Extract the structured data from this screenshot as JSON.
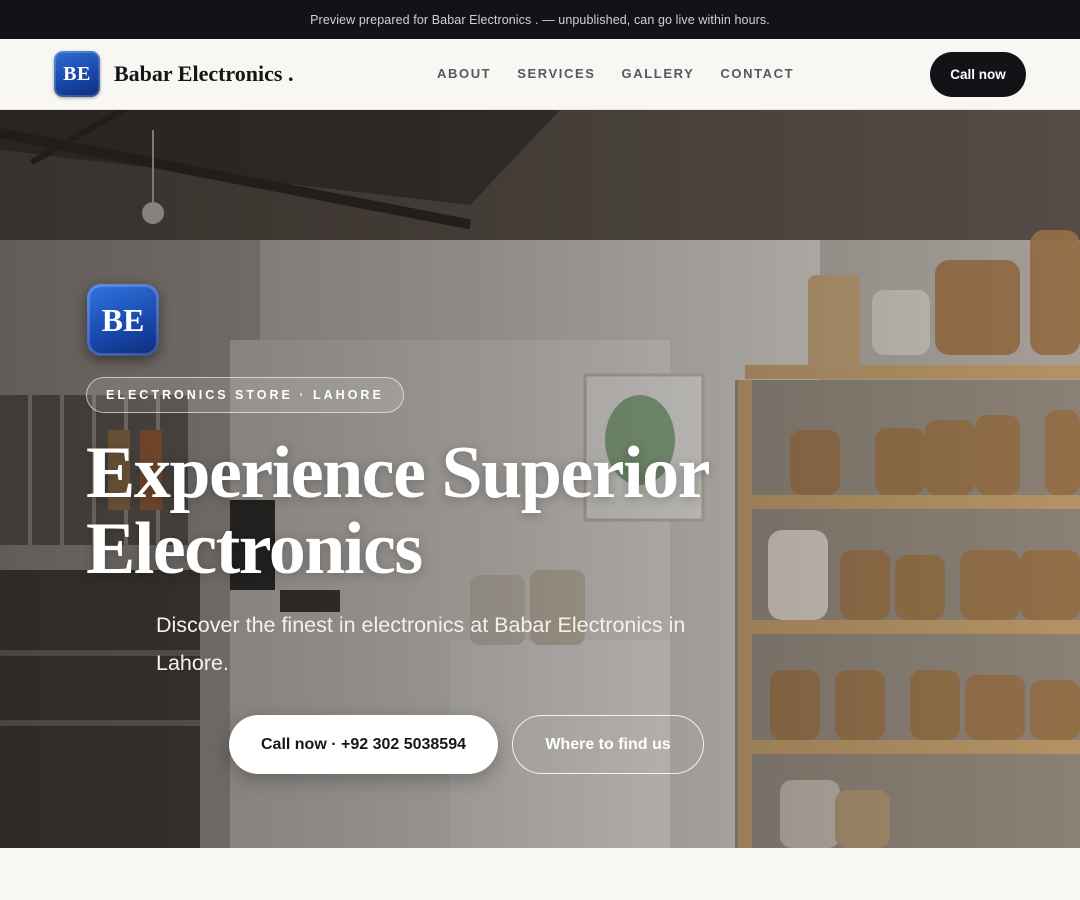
{
  "banner": {
    "text": "Preview prepared for Babar Electronics . — unpublished, can go live within hours."
  },
  "brand": {
    "logo_text": "BE",
    "name": "Babar Electronics .",
    "logo_color": "#1848a8"
  },
  "nav": {
    "items": [
      "ABOUT",
      "SERVICES",
      "GALLERY",
      "CONTACT"
    ]
  },
  "header": {
    "cta_label": "Call now"
  },
  "hero": {
    "background_image": "store interior with shelves of glass jars",
    "logo_text": "BE",
    "tag": "ELECTRONICS STORE · LAHORE",
    "title": "Experience Superior Electronics",
    "subtitle": "Discover the finest in electronics at Babar Electronics in Lahore.",
    "primary_cta": "Call now · +92 302 5038594",
    "secondary_cta": "Where to find us"
  },
  "colors": {
    "dark": "#121317",
    "page_bg": "#f9f7f3",
    "white": "#ffffff"
  }
}
